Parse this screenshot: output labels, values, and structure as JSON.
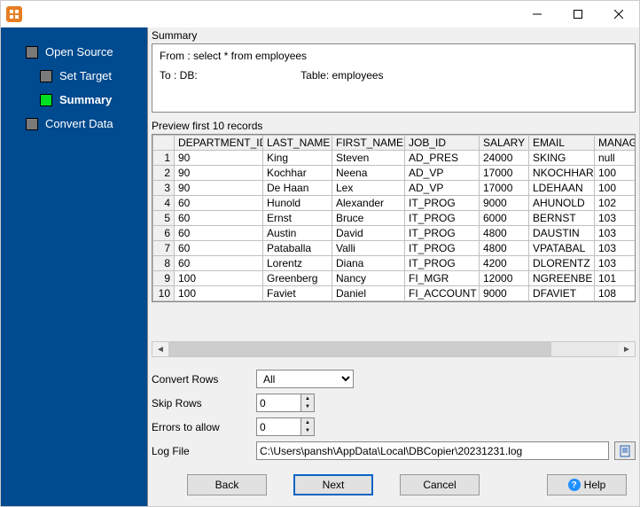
{
  "sidebar": {
    "items": [
      {
        "label": "Open Source"
      },
      {
        "label": "Set Target"
      },
      {
        "label": "Summary"
      },
      {
        "label": "Convert Data"
      }
    ]
  },
  "summary": {
    "heading": "Summary",
    "from": "From : select * from employees",
    "to": "To : DB:                                   Table: employees"
  },
  "preview": {
    "heading": "Preview first 10 records",
    "columns": [
      "DEPARTMENT_ID",
      "LAST_NAME",
      "FIRST_NAME",
      "JOB_ID",
      "SALARY",
      "EMAIL",
      "MANAG"
    ],
    "rows": [
      [
        "90",
        "King",
        "Steven",
        "AD_PRES",
        "24000",
        "SKING",
        "null"
      ],
      [
        "90",
        "Kochhar",
        "Neena",
        "AD_VP",
        "17000",
        "NKOCHHAR",
        "100"
      ],
      [
        "90",
        "De Haan",
        "Lex",
        "AD_VP",
        "17000",
        "LDEHAAN",
        "100"
      ],
      [
        "60",
        "Hunold",
        "Alexander",
        "IT_PROG",
        "9000",
        "AHUNOLD",
        "102"
      ],
      [
        "60",
        "Ernst",
        "Bruce",
        "IT_PROG",
        "6000",
        "BERNST",
        "103"
      ],
      [
        "60",
        "Austin",
        "David",
        "IT_PROG",
        "4800",
        "DAUSTIN",
        "103"
      ],
      [
        "60",
        "Pataballa",
        "Valli",
        "IT_PROG",
        "4800",
        "VPATABAL",
        "103"
      ],
      [
        "60",
        "Lorentz",
        "Diana",
        "IT_PROG",
        "4200",
        "DLORENTZ",
        "103"
      ],
      [
        "100",
        "Greenberg",
        "Nancy",
        "FI_MGR",
        "12000",
        "NGREENBE",
        "101"
      ],
      [
        "100",
        "Faviet",
        "Daniel",
        "FI_ACCOUNT",
        "9000",
        "DFAVIET",
        "108"
      ]
    ]
  },
  "form": {
    "convert_rows_label": "Convert Rows",
    "convert_rows_value": "All",
    "skip_rows_label": "Skip Rows",
    "skip_rows_value": "0",
    "errors_label": "Errors to allow",
    "errors_value": "0",
    "logfile_label": "Log File",
    "logfile_value": "C:\\Users\\pansh\\AppData\\Local\\DBCopier\\20231231.log"
  },
  "buttons": {
    "back": "Back",
    "next": "Next",
    "cancel": "Cancel",
    "help": "Help"
  }
}
